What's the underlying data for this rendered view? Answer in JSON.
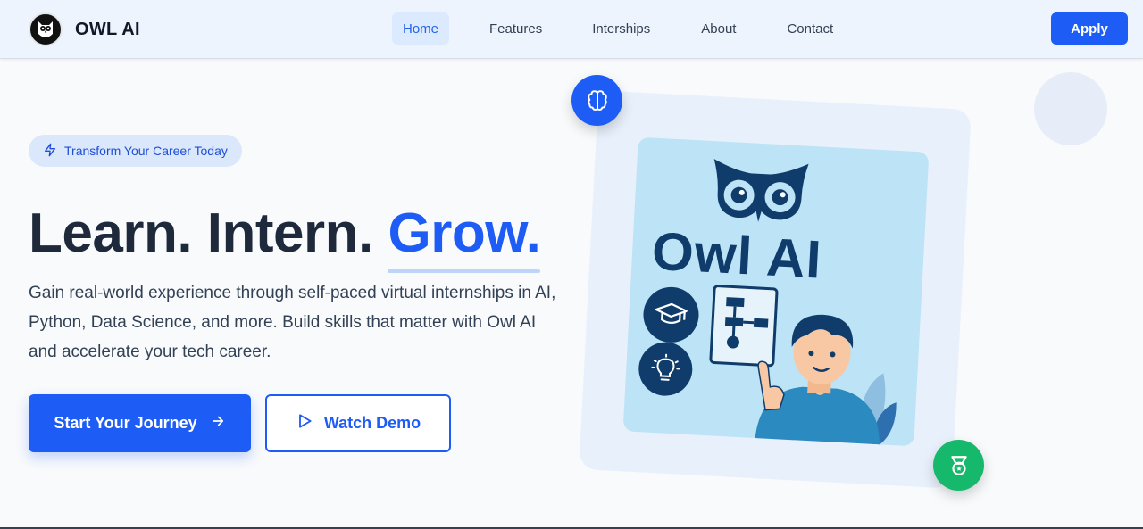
{
  "nav": {
    "brand": "OWL AI",
    "links": [
      {
        "label": "Home",
        "active": true
      },
      {
        "label": "Features",
        "active": false
      },
      {
        "label": "Interships",
        "active": false
      },
      {
        "label": "About",
        "active": false
      },
      {
        "label": "Contact",
        "active": false
      }
    ],
    "apply_label": "Apply"
  },
  "hero": {
    "badge": "Transform Your Career Today",
    "headline_part1": "Learn. Intern. ",
    "headline_highlight": "Grow.",
    "description": "Gain real-world experience through self-paced virtual internships in AI, Python, Data Science, and more. Build skills that matter with Owl AI and accelerate your tech career.",
    "primary_cta": "Start Your Journey",
    "secondary_cta": "Watch Demo"
  },
  "illustration": {
    "title": "Owl AI",
    "icons": [
      "brain-icon",
      "award-icon",
      "graduation-cap-icon",
      "lightbulb-icon"
    ]
  },
  "colors": {
    "accent": "#1d5cf5",
    "success": "#16b86b",
    "heading": "#1e293b",
    "illustration_navy": "#0f3c6b"
  }
}
